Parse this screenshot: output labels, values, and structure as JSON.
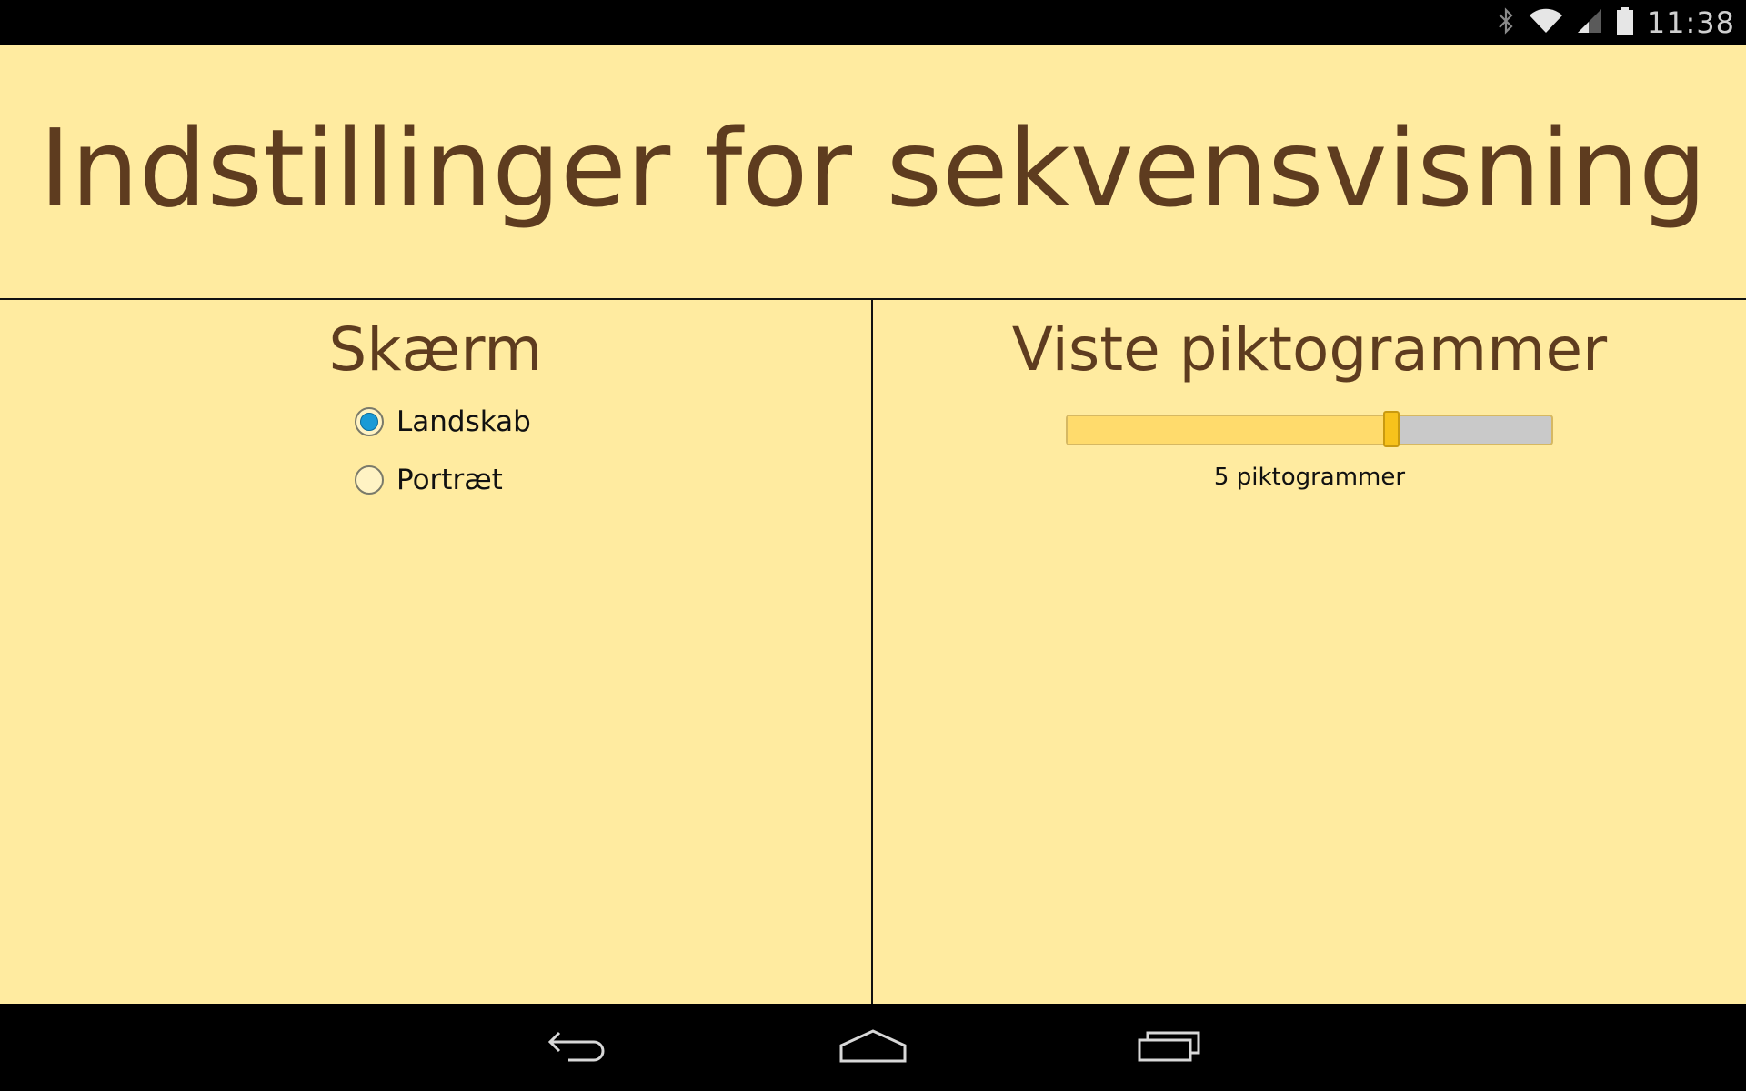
{
  "status_bar": {
    "time": "11:38",
    "icons": [
      "bluetooth-icon",
      "wifi-icon",
      "signal-icon",
      "battery-icon"
    ]
  },
  "header": {
    "title": "Indstillinger for sekvensvisning"
  },
  "display_section": {
    "title": "Skærm",
    "options": [
      {
        "label": "Landskab",
        "selected": true
      },
      {
        "label": "Portræt",
        "selected": false
      }
    ]
  },
  "pictogram_section": {
    "title": "Viste piktogrammer",
    "slider_fraction": 0.67,
    "value_label": "5 piktogrammer"
  },
  "nav_bar": {
    "buttons": [
      "back-icon",
      "home-icon",
      "recents-icon"
    ]
  },
  "colors": {
    "background": "#ffeba0",
    "title_text": "#5e3c1f",
    "slider_fill": "#ffdb6c",
    "slider_track": "#c9c9c9",
    "slider_thumb": "#f7c21c",
    "radio_selected": "#1a9ad6"
  }
}
